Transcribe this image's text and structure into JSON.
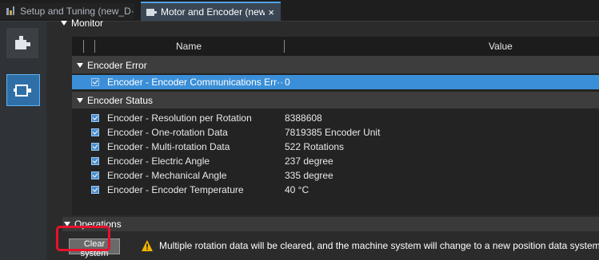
{
  "tabs": [
    {
      "label": "Setup and Tuning (new_D···",
      "active": false
    },
    {
      "label": "Motor and Encoder (new···",
      "active": true,
      "close": "×"
    }
  ],
  "monitor": {
    "title": "Monitor",
    "columns": {
      "name": "Name",
      "value": "Value"
    },
    "groups": [
      {
        "label": "Encoder Error",
        "rows": [
          {
            "name": "Encoder - Encoder Communications Err···",
            "value": "0",
            "selected": true
          }
        ]
      },
      {
        "label": "Encoder Status",
        "rows": [
          {
            "name": "Encoder - Resolution per Rotation",
            "value": "8388608"
          },
          {
            "name": "Encoder - One-rotation Data",
            "value": "7819385 Encoder Unit"
          },
          {
            "name": "Encoder - Multi-rotation Data",
            "value": "522 Rotations"
          },
          {
            "name": "Encoder - Electric Angle",
            "value": "237 degree"
          },
          {
            "name": "Encoder - Mechanical Angle",
            "value": "335 degree"
          },
          {
            "name": "Encoder - Encoder Temperature",
            "value": "40 °C"
          }
        ]
      }
    ]
  },
  "operations": {
    "title": "Operations",
    "clear_button": "Clear system",
    "message": "Multiple rotation data will be cleared, and the machine system will change to a new position data system."
  },
  "colors": {
    "accent": "#3b8fd8",
    "highlight": "#e8112d",
    "warning": "#f2b600"
  },
  "icons": [
    "setup-icon",
    "motor-icon",
    "motor-encoder-icon",
    "close-icon",
    "checkbox-icon",
    "warning-icon"
  ]
}
